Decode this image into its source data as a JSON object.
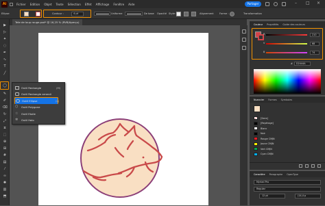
{
  "menubar": {
    "logo": "Ai",
    "items": [
      "Fichier",
      "Edition",
      "Objet",
      "Texte",
      "Sélection",
      "Effet",
      "Affichage",
      "Fenêtre",
      "Aide"
    ],
    "share_label": "Partager"
  },
  "control_bar": {
    "selection_label": "Ellipse",
    "contour_label": "Contour :",
    "contour_value": "4 pt",
    "profile_label": "Uniforme",
    "brush_label": "De base",
    "opacity_label": "Opacité",
    "style_label": "Style :",
    "align_label": "Alignement",
    "shape_label": "Forme :",
    "transform_label": "Transformation"
  },
  "document_tab": {
    "title": "Tete de loup rouge.psd* @ 16,25 % (RVB/Aperçu)"
  },
  "tool_flyout": {
    "items": [
      {
        "label": "Outil Rectangle",
        "shortcut": "(M)",
        "icon": "rectangle-icon"
      },
      {
        "label": "Outil Rectangle arrondi",
        "shortcut": "",
        "icon": "rounded-rectangle-icon"
      },
      {
        "label": "Outil Ellipse",
        "shortcut": "(L)",
        "icon": "ellipse-icon",
        "active": true
      },
      {
        "label": "Outil Polygone",
        "shortcut": "",
        "icon": "polygon-icon"
      },
      {
        "label": "Outil Etoile",
        "shortcut": "",
        "icon": "star-icon"
      },
      {
        "label": "Outil Halo",
        "shortcut": "",
        "icon": "flare-icon"
      }
    ]
  },
  "color_panel": {
    "tabs": [
      "Couleur",
      "Propriétés",
      "Guide des couleurs"
    ],
    "sliders": [
      {
        "label": "R",
        "value": "210",
        "color": "#ff3b3b"
      },
      {
        "label": "V",
        "value": "68",
        "color": "#3bd43b"
      },
      {
        "label": "B",
        "value": "74",
        "color": "#3b6bff"
      }
    ],
    "hex_label": "#",
    "hex_value": "D2444A",
    "fill_color": "#d2444a"
  },
  "swatches_panel": {
    "tabs": [
      "Nuancier",
      "Formes",
      "Symboles"
    ],
    "items": [
      {
        "label": "[Sans]",
        "color": "#ffffff"
      },
      {
        "label": "[Repérage]",
        "color": "#000000"
      },
      {
        "label": "Blanc",
        "color": "#ffffff"
      },
      {
        "label": "Noir",
        "color": "#000000"
      },
      {
        "label": "Rouge CMJN",
        "color": "#ed1c24"
      },
      {
        "label": "Jaune CMJN",
        "color": "#fff200"
      },
      {
        "label": "Vert CMJN",
        "color": "#00a651"
      },
      {
        "label": "Cyan CMJN",
        "color": "#00aeef"
      }
    ]
  },
  "character_panel": {
    "tabs": [
      "Caractère",
      "Paragraphe",
      "OpenType"
    ],
    "font": "Myriad Pro",
    "style": "Regular",
    "size": "12 pt",
    "leading": "(14,4 p"
  },
  "artwork": {
    "circle_fill": "#f9dfc3",
    "circle_stroke": "#8c3f78",
    "wolf_color": "#c94a4a"
  }
}
